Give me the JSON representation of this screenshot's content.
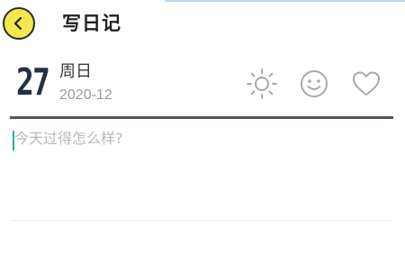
{
  "header": {
    "title": "写日记",
    "back_icon": "chevron-left-icon"
  },
  "date": {
    "day": "27",
    "weekday": "周日",
    "month": "2020-12"
  },
  "toolbar": {
    "weather_icon": "sun-icon",
    "mood_icon": "smiley-icon",
    "favorite_icon": "heart-icon"
  },
  "editor": {
    "value": "",
    "placeholder": "今天过得怎么样?"
  },
  "colors": {
    "back_button": "#f3e84e",
    "divider": "#4e5661",
    "icon_gray": "#a9a9a9",
    "cursor": "#19b39a"
  }
}
